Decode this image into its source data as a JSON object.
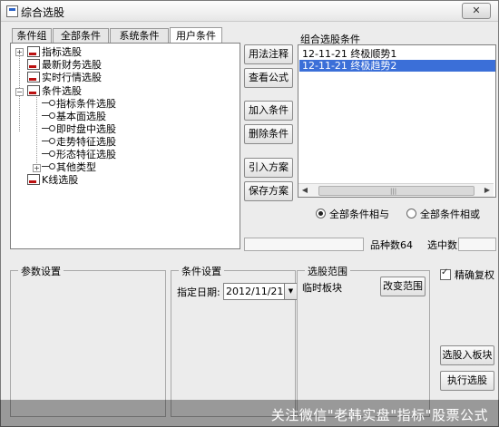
{
  "window": {
    "title": "综合选股",
    "close_glyph": "✕"
  },
  "tabs": [
    "条件组",
    "全部条件",
    "系统条件",
    "用户条件"
  ],
  "tree": {
    "items": [
      {
        "label": "指标选股",
        "icon": "doc-chart-icon",
        "toggle": "+"
      },
      {
        "label": "最新财务选股",
        "icon": "doc-chart-icon"
      },
      {
        "label": "实时行情选股",
        "icon": "doc-chart-icon"
      },
      {
        "label": "条件选股",
        "icon": "doc-chart-icon",
        "toggle": "−"
      },
      {
        "label": "指标条件选股",
        "icon": "key-icon"
      },
      {
        "label": "基本面选股",
        "icon": "key-icon"
      },
      {
        "label": "即时盘中选股",
        "icon": "key-icon"
      },
      {
        "label": "走势特征选股",
        "icon": "key-icon"
      },
      {
        "label": "形态特征选股",
        "icon": "key-icon"
      },
      {
        "label": "其他类型",
        "icon": "key-icon",
        "toggle": "+"
      },
      {
        "label": "K线选股",
        "icon": "doc-chart-icon"
      }
    ]
  },
  "buttons": {
    "usage": "用法注释",
    "view_formula": "查看公式",
    "add_condition": "加入条件",
    "delete_condition": "删除条件",
    "import_scheme": "引入方案",
    "save_scheme": "保存方案",
    "change_range": "改变范围",
    "select_to_block": "选股入板块",
    "execute": "执行选股"
  },
  "combo": {
    "label": "组合选股条件",
    "rows": [
      {
        "text": "12-11-21  终极顺势1",
        "selected": false
      },
      {
        "text": "12-11-21  终极趋势2",
        "selected": true
      }
    ]
  },
  "logic": {
    "and_label": "全部条件相与",
    "or_label": "全部条件相或",
    "selected": "and"
  },
  "stats": {
    "count_label": "品种数",
    "count_value": "64",
    "selected_label": "选中数"
  },
  "params": {
    "label": "参数设置"
  },
  "cond_settings": {
    "label": "条件设置",
    "date_label": "指定日期:",
    "date_value": "2012/11/21"
  },
  "range": {
    "label": "选股范围",
    "value": "临时板块"
  },
  "precise": {
    "label": "精确复权",
    "checked": true
  },
  "watermark": {
    "text": "关注微信\"老韩实盘\"指标\"股票公式"
  },
  "colors": {
    "selection": "#3b6fd8",
    "window_bg": "#ececec"
  }
}
